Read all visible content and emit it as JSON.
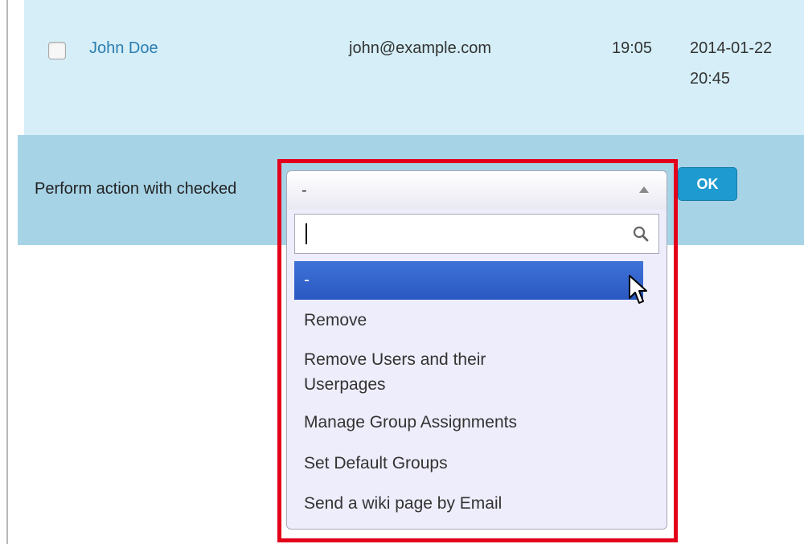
{
  "row": {
    "name": "John Doe",
    "email": "john@example.com",
    "time": "19:05",
    "date": "2014-01-22",
    "date_time": "20:45"
  },
  "actions": {
    "label": "Perform action with checked",
    "selected_value": "-",
    "search_value": "",
    "ok_label": "OK",
    "options": [
      "-",
      "Remove",
      "Remove Users and their",
      "Userpages",
      "Manage Group Assignments",
      "Set Default Groups",
      "Send a wiki page by Email"
    ]
  },
  "icons": {
    "search": "search-icon",
    "arrow": "triangle-up-icon",
    "cursor": "mouse-pointer-icon"
  },
  "colors": {
    "row_bg": "#d5eef7",
    "action_bar_bg": "#a7d3e6",
    "link": "#2b7eb0",
    "ok_button": "#1f9ad0",
    "selected_option": "#2f60c8",
    "highlight_frame": "#e3001b"
  }
}
